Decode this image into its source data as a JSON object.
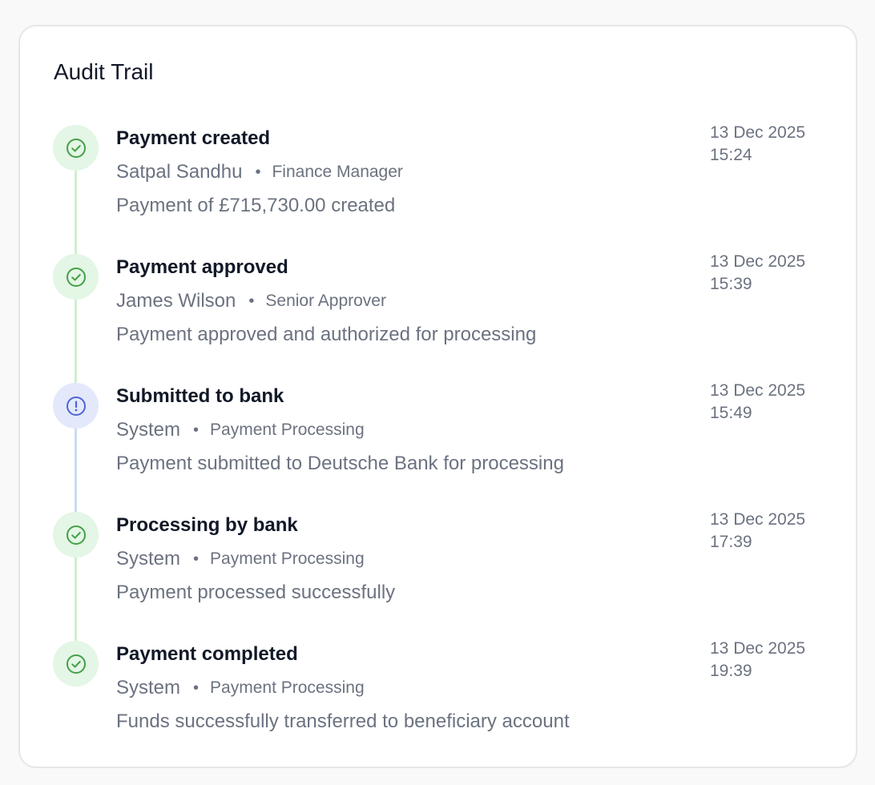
{
  "card": {
    "title": "Audit Trail"
  },
  "colors": {
    "success": "#43a047",
    "success_bg": "#e4f6e5",
    "success_line": "#ccefcf",
    "info": "#4f63d9",
    "info_bg": "#e3e9fb",
    "info_line": "#c9dbf3"
  },
  "events": [
    {
      "status": "success",
      "icon": "check-circle-icon",
      "title": "Payment created",
      "actor": "Satpal Sandhu",
      "separator": "•",
      "role": "Finance Manager",
      "description": "Payment of £715,730.00 created",
      "date": "13 Dec 2025",
      "time": "15:24"
    },
    {
      "status": "success",
      "icon": "check-circle-icon",
      "title": "Payment approved",
      "actor": "James Wilson",
      "separator": "•",
      "role": "Senior Approver",
      "description": "Payment approved and authorized for processing",
      "date": "13 Dec 2025",
      "time": "15:39"
    },
    {
      "status": "info",
      "icon": "alert-circle-icon",
      "title": "Submitted to bank",
      "actor": "System",
      "separator": "•",
      "role": "Payment Processing",
      "description": "Payment submitted to Deutsche Bank for processing",
      "date": "13 Dec 2025",
      "time": "15:49"
    },
    {
      "status": "success",
      "icon": "check-circle-icon",
      "title": "Processing by bank",
      "actor": "System",
      "separator": "•",
      "role": "Payment Processing",
      "description": "Payment processed successfully",
      "date": "13 Dec 2025",
      "time": "17:39"
    },
    {
      "status": "success",
      "icon": "check-circle-icon",
      "title": "Payment completed",
      "actor": "System",
      "separator": "•",
      "role": "Payment Processing",
      "description": "Funds successfully transferred to beneficiary account",
      "date": "13 Dec 2025",
      "time": "19:39"
    }
  ]
}
